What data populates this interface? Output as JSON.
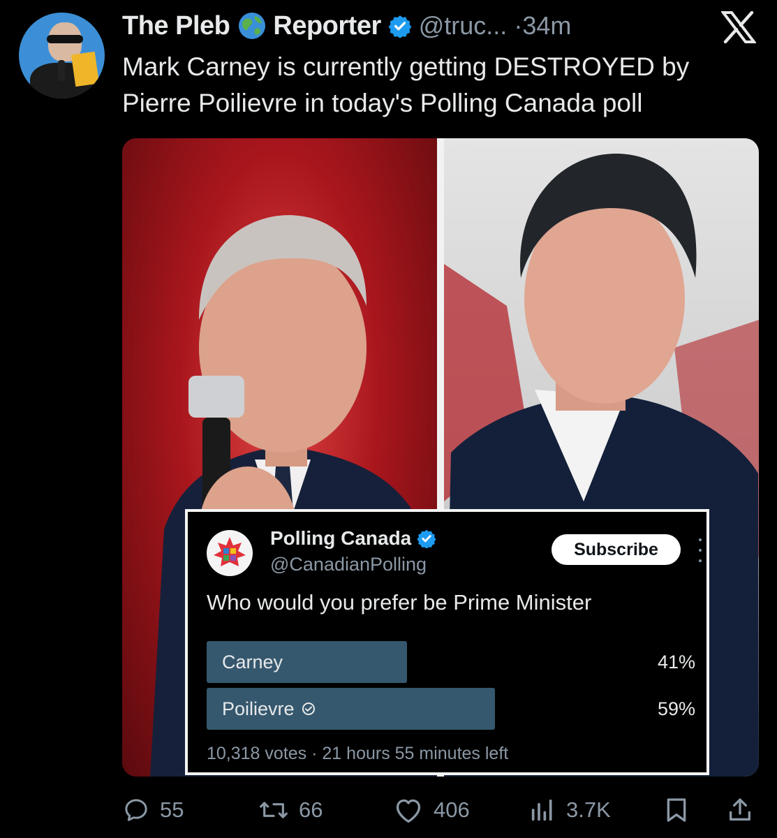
{
  "author": {
    "name_first": "The Pleb",
    "name_second": "Reporter",
    "handle": "@truc...",
    "separator": "·",
    "time": "34m"
  },
  "tweet": {
    "text_line1": "Mark Carney is currently getting DESTROYED by",
    "text_line2": "Pierre Poilievre in today's Polling Canada poll"
  },
  "poll": {
    "account_name": "Polling Canada",
    "account_handle": "@CanadianPolling",
    "subscribe_label": "Subscribe",
    "question": "Who would you prefer be Prime Minister",
    "options": [
      {
        "label": "Carney",
        "percent": 41,
        "percent_text": "41%",
        "winner": false
      },
      {
        "label": "Poilievre",
        "percent": 59,
        "percent_text": "59%",
        "winner": true
      }
    ],
    "votes": "10,318 votes",
    "dot": "·",
    "time_left": "21 hours 55 minutes left"
  },
  "actions": {
    "replies": "55",
    "reposts": "66",
    "likes": "406",
    "views": "3.7K"
  },
  "colors": {
    "background": "#000000",
    "text": "#e7e9ea",
    "muted": "#8b98a5",
    "verified_blue": "#1d9bf0",
    "poll_bar": "#36586e"
  },
  "icons": [
    "globe-icon",
    "verified-badge-icon",
    "x-logo-icon",
    "reply-icon",
    "repost-icon",
    "like-icon",
    "views-icon",
    "bookmark-icon",
    "share-icon",
    "check-circle-icon"
  ]
}
